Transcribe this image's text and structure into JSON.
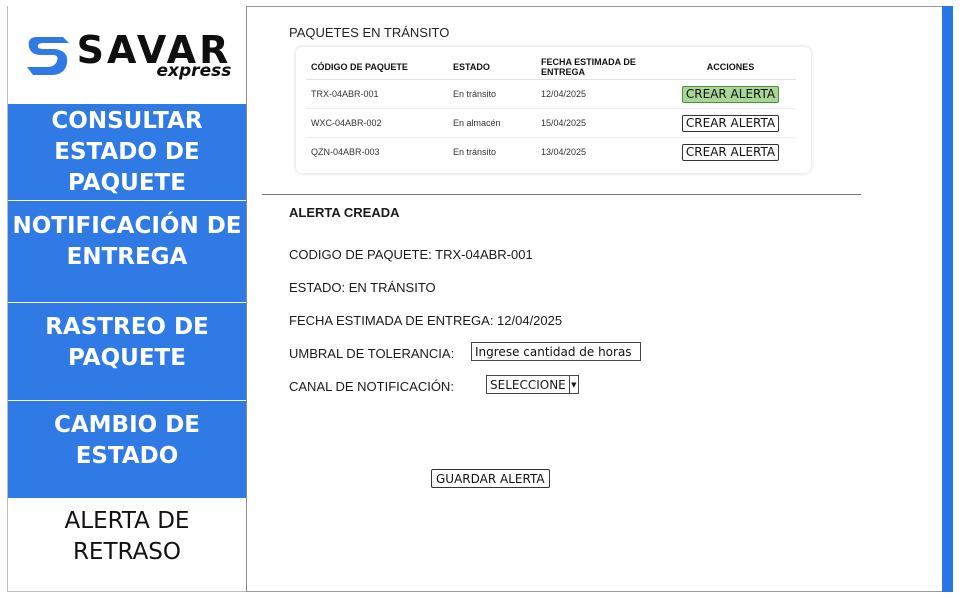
{
  "brand": {
    "name": "SAVAR",
    "sub": "express",
    "accent_color": "#2f7ae5"
  },
  "sidebar": {
    "items": [
      {
        "lines": [
          "CONSULTAR",
          "ESTADO DE",
          "PAQUETE"
        ]
      },
      {
        "lines": [
          "NOTIFICACIÓN DE",
          "ENTREGA"
        ]
      },
      {
        "lines": [
          "RASTREO DE",
          "PAQUETE"
        ]
      },
      {
        "lines": [
          "CAMBIO DE",
          "ESTADO"
        ]
      },
      {
        "lines": [
          "ALERTA DE",
          "RETRASO"
        ]
      }
    ]
  },
  "packages": {
    "title": "PAQUETES EN TRÁNSITO",
    "headers": [
      "CÓDIGO DE PAQUETE",
      "ESTADO",
      "FECHA ESTIMADA DE ENTREGA",
      "ACCIONES"
    ],
    "rows": [
      {
        "code": "TRX-04ABR-001",
        "status": "En tránsito",
        "date": "12/04/2025",
        "action": "CREAR ALERTA"
      },
      {
        "code": "WXC-04ABR-002",
        "status": "En almacén",
        "date": "15/04/2025",
        "action": "CREAR ALERTA"
      },
      {
        "code": "QZN-04ABR-003",
        "status": "En tránsito",
        "date": "13/04/2025",
        "action": "CREAR ALERTA"
      }
    ]
  },
  "alert": {
    "title": "ALERTA CREADA",
    "code_line": "CODIGO DE PAQUETE: TRX-04ABR-001",
    "status_line": "ESTADO: EN TRÁNSITO",
    "date_line": "FECHA ESTIMADA DE ENTREGA: 12/04/2025",
    "threshold_label": "UMBRAL DE TOLERANCIA:",
    "threshold_placeholder": "Ingrese cantidad de horas",
    "channel_label": "CANAL DE NOTIFICACIÓN:",
    "channel_value": "SELECCIONE",
    "save_label": "GUARDAR ALERTA"
  }
}
